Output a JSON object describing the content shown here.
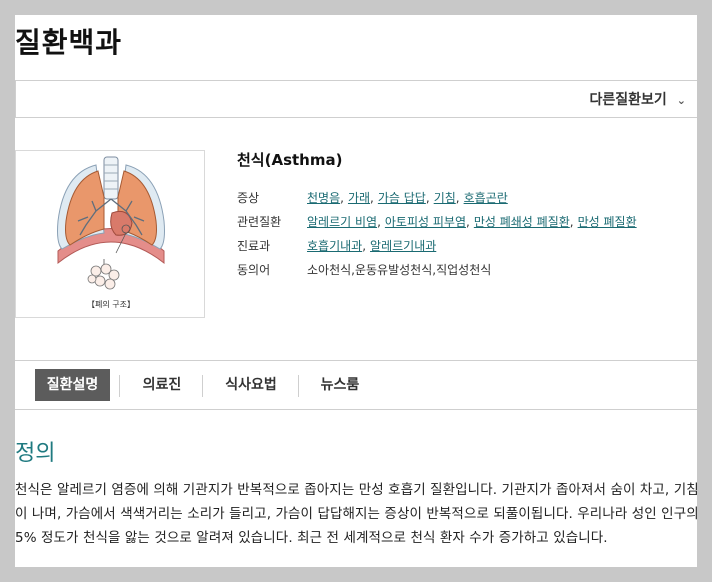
{
  "page_title": "질환백과",
  "other_disease_button": "다른질환보기",
  "figure_caption": "【폐의 구조】",
  "disease": {
    "name": "천식(Asthma)",
    "rows": [
      {
        "label": "증상",
        "links": [
          "천명음",
          "가래",
          "가슴 답답",
          "기침",
          "호흡곤란"
        ]
      },
      {
        "label": "관련질환",
        "links": [
          "알레르기 비염",
          "아토피성 피부염",
          "만성 폐쇄성 폐질환",
          "만성 폐질환"
        ]
      },
      {
        "label": "진료과",
        "links": [
          "호흡기내과",
          "알레르기내과"
        ]
      },
      {
        "label": "동의어",
        "text": "소아천식,운동유발성천식,직업성천식"
      }
    ]
  },
  "tabs": [
    "질환설명",
    "의료진",
    "식사요법",
    "뉴스룸"
  ],
  "active_tab": "질환설명",
  "section": {
    "title": "정의",
    "body": "천식은 알레르기 염증에 의해 기관지가 반복적으로 좁아지는 만성 호흡기 질환입니다. 기관지가 좁아져서 숨이 차고, 기침이 나며, 가슴에서 색색거리는 소리가 들리고, 가슴이 답답해지는 증상이 반복적으로 되풀이됩니다. 우리나라 성인 인구의 5% 정도가 천식을 앓는 것으로 알려져 있습니다. 최근 전 세계적으로 천식 환자 수가 증가하고 있습니다."
  },
  "icons": {
    "dropdown": "chevron-down-icon",
    "illustration": "lungs-illustration"
  }
}
